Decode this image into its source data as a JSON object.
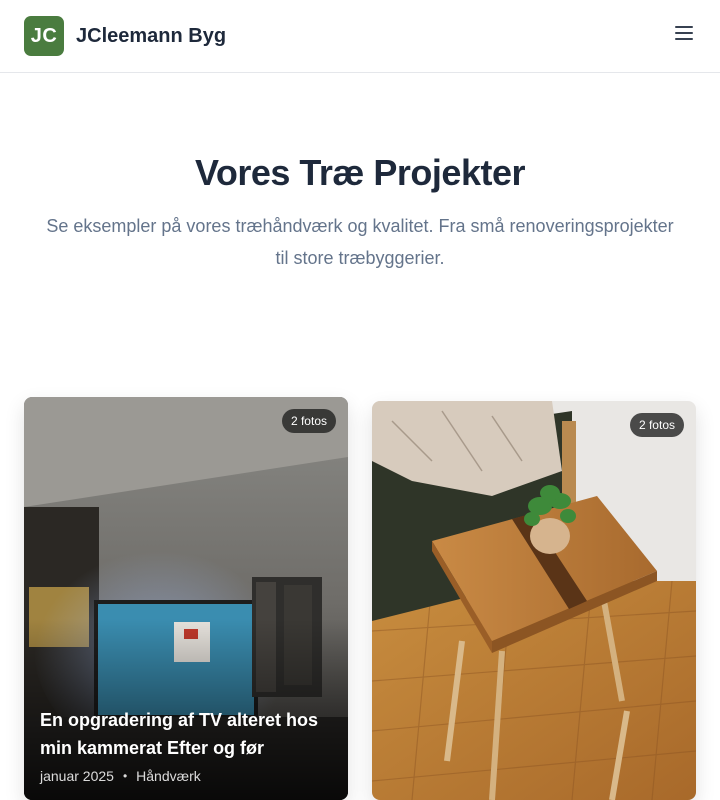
{
  "header": {
    "logo_initials": "JC",
    "brand_name": "JCleemann Byg"
  },
  "hero": {
    "title": "Vores Træ Projekter",
    "subtitle_line1": "Se eksempler på vores træhåndværk og kvalitet. Fra små renoveringsprojekter",
    "subtitle_line2": "til store træbyggerier."
  },
  "projects": [
    {
      "photo_count": "2 fotos",
      "title": "En opgradering af TV alteret hos min kammerat Efter og før",
      "date": "januar 2025",
      "separator": "•",
      "category": "Håndværk"
    },
    {
      "photo_count": "2 fotos"
    }
  ],
  "colors": {
    "brand_green": "#4a7c3f",
    "heading": "#1e293b",
    "muted_text": "#64748b"
  },
  "icons": {
    "menu": "hamburger-menu-icon"
  }
}
